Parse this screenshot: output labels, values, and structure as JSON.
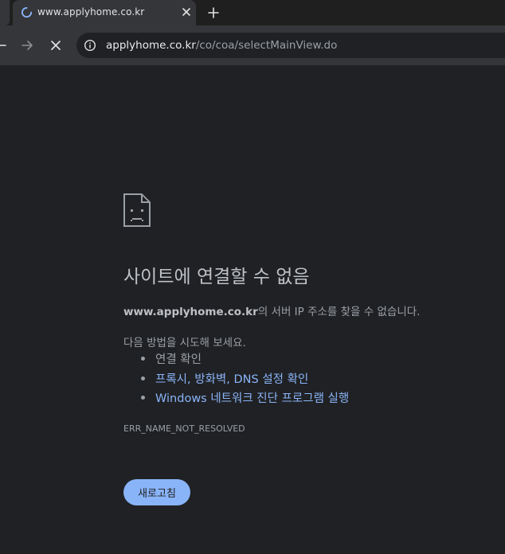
{
  "browser": {
    "tab": {
      "title": "www.applyhome.co.kr",
      "loading_icon": "spinner-icon",
      "close_icon": "close-icon"
    },
    "new_tab_icon": "plus-icon",
    "nav": {
      "back_icon": "back-arrow-icon",
      "forward_icon": "forward-arrow-icon",
      "stop_icon": "stop-icon"
    },
    "omnibox": {
      "site_info_icon": "info-icon",
      "url_host": "applyhome.co.kr",
      "url_path": "/co/coa/selectMainView.do"
    }
  },
  "error_page": {
    "icon": "sad-document-icon",
    "title": "사이트에 연결할 수 없음",
    "description_host": "www.applyhome.co.kr",
    "description_rest": "의 서버 IP 주소를 찾을 수 없습니다.",
    "suggestions_heading": "다음 방법을 시도해 보세요.",
    "suggestions": [
      {
        "label": "연결 확인",
        "is_link": false
      },
      {
        "label": "프록시, 방화벽, DNS 설정 확인",
        "is_link": true
      },
      {
        "label": "Windows 네트워크 진단 프로그램 실행",
        "is_link": true
      }
    ],
    "error_code": "ERR_NAME_NOT_RESOLVED",
    "reload_label": "새로고침"
  },
  "colors": {
    "page_background": "#202124",
    "toolbar_background": "#35363a",
    "link": "#8ab4f8",
    "button_background": "#8ab4f8",
    "text_primary": "#bdc1c6",
    "text_secondary": "#9aa0a6"
  }
}
